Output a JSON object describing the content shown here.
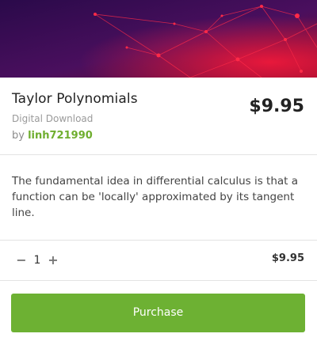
{
  "product": {
    "title": "Taylor Polynomials",
    "type": "Digital Download",
    "by_prefix": "by",
    "author": "linh721990",
    "price": "$9.95",
    "description": "The fundamental idea in differential calculus is that a function can be 'locally' approximated by its tangent line."
  },
  "cart": {
    "minus_icon": "minus-icon",
    "plus_icon": "plus-icon",
    "minus_label": "−",
    "plus_label": "+",
    "quantity": "1",
    "line_total": "$9.95"
  },
  "actions": {
    "purchase_label": "Purchase"
  },
  "colors": {
    "accent": "#6db133",
    "author": "#6fae2f",
    "banner_dark": "#3a0f5c",
    "banner_red": "#e0123c"
  }
}
